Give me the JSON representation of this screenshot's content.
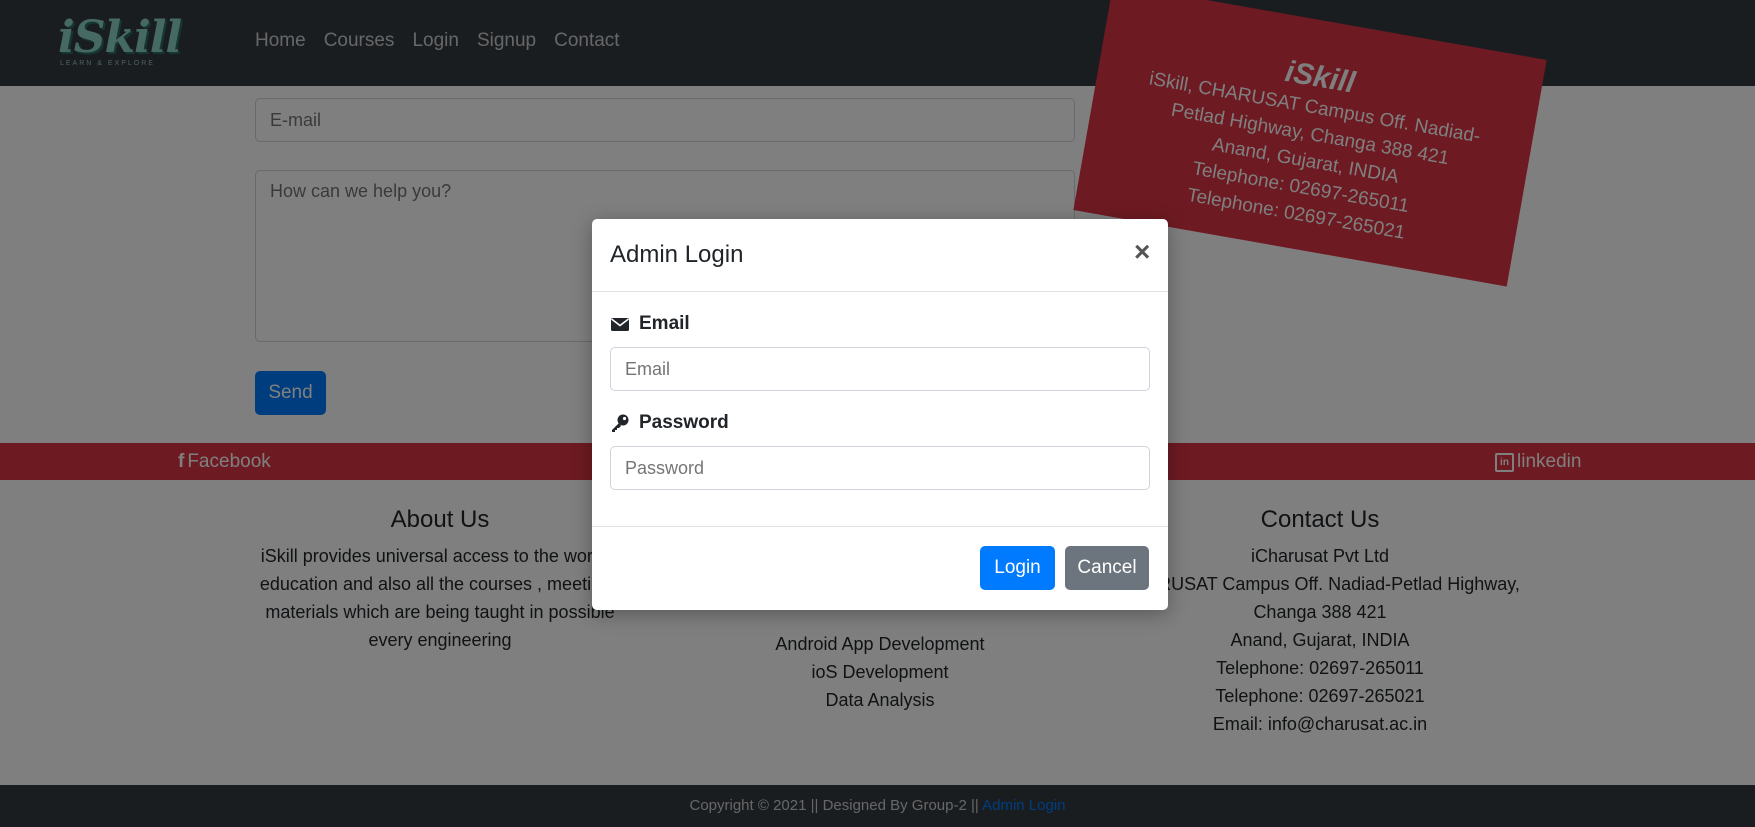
{
  "navbar": {
    "logo_text": "iSkill",
    "logo_tagline": "LEARN & EXPLORE",
    "links": [
      "Home",
      "Courses",
      "Login",
      "Signup",
      "Contact"
    ]
  },
  "contact_form": {
    "email_placeholder": "E-mail",
    "message_placeholder": "How can we help you?",
    "send_label": "Send"
  },
  "address_card": {
    "title": "iSkill",
    "lines": [
      "iSkill, CHARUSAT Campus Off. Nadiad-",
      "Petlad Highway, Changa 388 421",
      "Anand, Gujarat, INDIA",
      "Telephone: 02697-265011",
      "Telephone: 02697-265021"
    ]
  },
  "social": {
    "facebook": "Facebook",
    "linkedin": "linkedin"
  },
  "footer": {
    "about": {
      "heading": "About Us",
      "lines": [
        "iSkill provides universal access to the world's",
        "education and also all the courses , meetings",
        "materials which are being taught in possible",
        "every engineering"
      ]
    },
    "courses": {
      "items": [
        "Android App Development",
        "ioS Development",
        "Data Analysis"
      ]
    },
    "contact": {
      "heading": "Contact Us",
      "lines": [
        "iCharusat Pvt Ltd",
        "CHARUSAT Campus Off. Nadiad-Petlad Highway,",
        "Changa 388 421",
        "Anand, Gujarat, INDIA",
        "Telephone: 02697-265011",
        "Telephone: 02697-265021",
        "Email: info@charusat.ac.in"
      ]
    }
  },
  "bottom_bar": {
    "copyright": "Copyright © 2021 || Designed By Group-2 ||",
    "admin_link": "Admin Login"
  },
  "modal": {
    "title": "Admin Login",
    "close_symbol": "×",
    "email_label": "Email",
    "email_placeholder": "Email",
    "password_label": "Password",
    "password_placeholder": "Password",
    "login_label": "Login",
    "cancel_label": "Cancel"
  },
  "colors": {
    "primary": "#007bff",
    "danger": "#dc3545",
    "dark": "#343a40",
    "secondary": "#6c757d"
  }
}
